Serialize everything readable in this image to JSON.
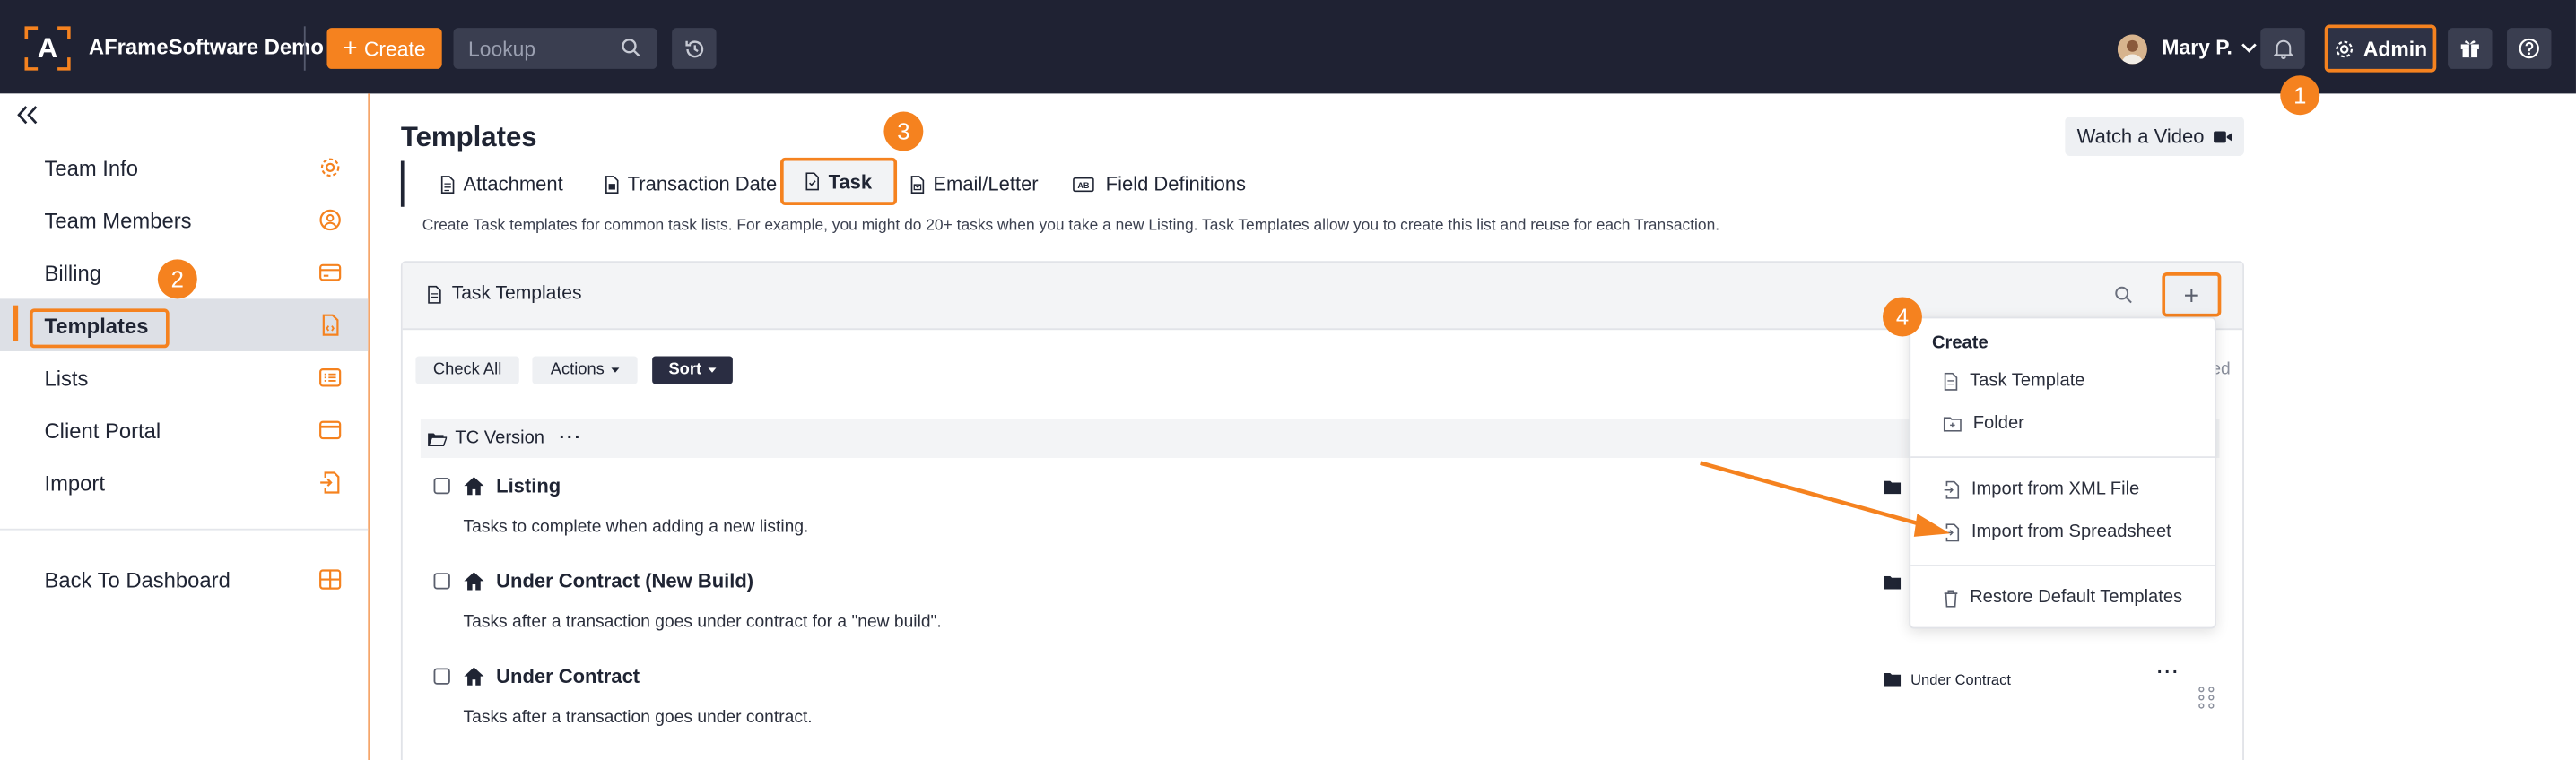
{
  "topbar": {
    "logo_letter": "A",
    "app_name": "AFrameSoftware Demo",
    "create_label": "Create",
    "lookup_placeholder": "Lookup",
    "user_name": "Mary P.",
    "admin_label": "Admin"
  },
  "sidebar": {
    "items": [
      {
        "label": "Team Info",
        "icon": "gear-icon"
      },
      {
        "label": "Team Members",
        "icon": "user-circle-icon"
      },
      {
        "label": "Billing",
        "icon": "credit-card-icon"
      },
      {
        "label": "Templates",
        "icon": "document-code-icon",
        "active": true
      },
      {
        "label": "Lists",
        "icon": "list-icon"
      },
      {
        "label": "Client Portal",
        "icon": "browser-window-icon"
      },
      {
        "label": "Import",
        "icon": "import-file-icon"
      }
    ],
    "back_label": "Back To Dashboard"
  },
  "main": {
    "title": "Templates",
    "watch_label": "Watch a Video",
    "tabs": [
      {
        "label": "Attachment"
      },
      {
        "label": "Transaction Date"
      },
      {
        "label": "Task",
        "active": true
      },
      {
        "label": "Email/Letter"
      },
      {
        "label": "Field Definitions"
      }
    ],
    "description": "Create Task templates for common task lists. For example, you might do 20+ tasks when you take a new Listing. Task Templates allow you to create this list and reuse for each Transaction.",
    "panel_title": "Task Templates",
    "toolbar": {
      "check_all": "Check All",
      "actions": "Actions",
      "sort": "Sort",
      "trailing_fragment": "ed"
    },
    "folder_label": "TC Version",
    "tasks": [
      {
        "title": "Listing",
        "description": "Tasks to complete when adding a new listing."
      },
      {
        "title": "Under Contract (New Build)",
        "description": "Tasks after a transaction goes under contract for a \"new build\"."
      },
      {
        "title": "Under Contract",
        "description": "Tasks after a transaction goes under contract.",
        "folder": "Under Contract"
      }
    ]
  },
  "dropdown": {
    "header": "Create",
    "items": [
      "Task Template",
      "Folder",
      "Import from XML File",
      "Import from Spreadsheet",
      "Restore Default Templates"
    ]
  },
  "callouts": [
    "1",
    "2",
    "3",
    "4"
  ],
  "colors": {
    "accent": "#f5821f",
    "topbar": "#1f2233",
    "sort_button": "#2a2d42"
  }
}
